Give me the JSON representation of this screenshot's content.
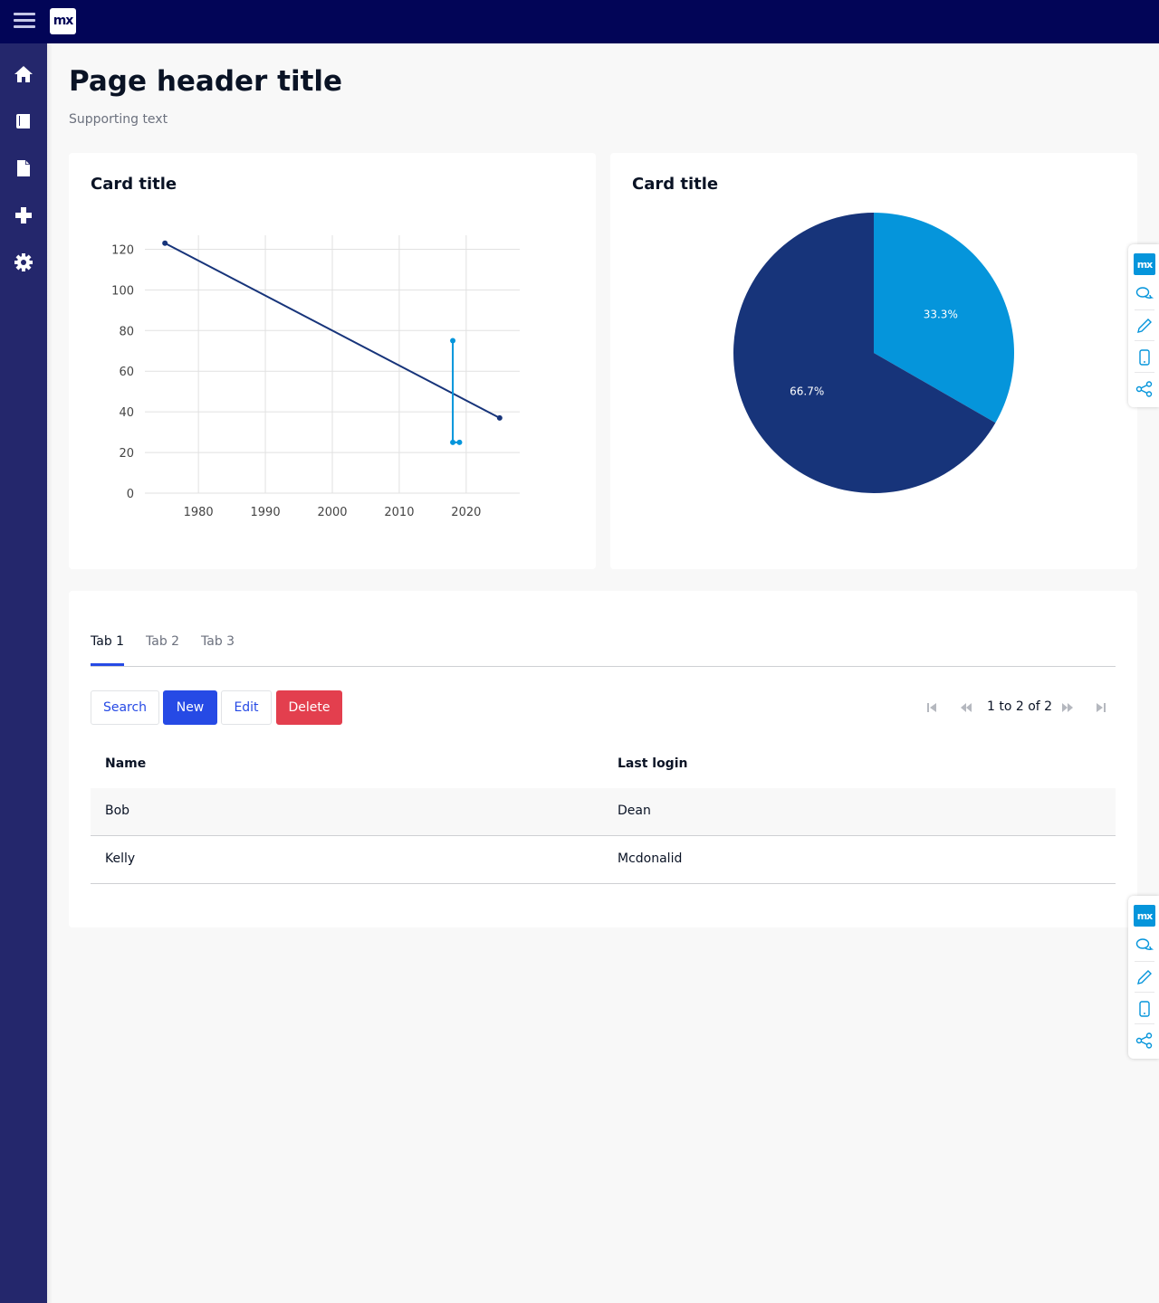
{
  "header": {
    "logo_text": "mx"
  },
  "sidebar": {
    "items": [
      {
        "icon": "home-icon"
      },
      {
        "icon": "book-icon"
      },
      {
        "icon": "document-icon"
      },
      {
        "icon": "plus-icon"
      },
      {
        "icon": "gear-icon"
      }
    ]
  },
  "page": {
    "title": "Page header title",
    "subtitle": "Supporting text"
  },
  "cards": [
    {
      "title": "Card title"
    },
    {
      "title": "Card title"
    }
  ],
  "chart_data": [
    {
      "type": "line",
      "xlim": [
        1972,
        2028
      ],
      "ylim": [
        0,
        130
      ],
      "xticks": [
        1980,
        1990,
        2000,
        2010,
        2020
      ],
      "yticks": [
        0,
        20,
        40,
        60,
        80,
        100,
        120
      ],
      "grid": true,
      "series": [
        {
          "color": "#17347a",
          "x": [
            1975,
            2025
          ],
          "y": [
            123,
            37
          ]
        },
        {
          "color": "#0595db",
          "x": [
            2018,
            2018,
            2019
          ],
          "y": [
            75,
            25,
            25
          ]
        }
      ]
    },
    {
      "type": "pie",
      "values": [
        33.3,
        66.7
      ],
      "labels": [
        "33.3%",
        "66.7%"
      ],
      "colors": [
        "#0595db",
        "#17347a"
      ]
    }
  ],
  "tabs": [
    "Tab 1",
    "Tab 2",
    "Tab 3"
  ],
  "toolbar": {
    "search": "Search",
    "new": "New",
    "edit": "Edit",
    "delete": "Delete"
  },
  "pager": {
    "text": "1 to 2 of 2"
  },
  "table": {
    "columns": [
      "Name",
      "Last login"
    ],
    "rows": [
      [
        "Bob",
        "Dean"
      ],
      [
        "Kelly",
        "Mcdonalid"
      ]
    ]
  },
  "dev_panel": {
    "logo_text": "mx"
  },
  "colors": {
    "topbar": "#020557",
    "sidebar": "#24276c",
    "primary": "#264ae5",
    "danger": "#e33f4e",
    "chart_dark": "#17347a",
    "chart_light": "#0595db"
  }
}
